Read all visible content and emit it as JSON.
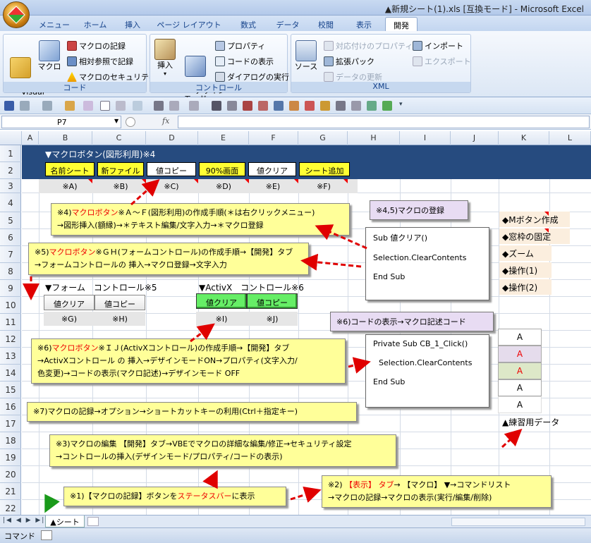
{
  "window": {
    "title": "▲新規シート(1).xls [互換モード] - Microsoft Excel"
  },
  "tabs": [
    {
      "label": "メニュー"
    },
    {
      "label": "ホーム"
    },
    {
      "label": "挿入"
    },
    {
      "label": "ページ レイアウト"
    },
    {
      "label": "数式"
    },
    {
      "label": "データ"
    },
    {
      "label": "校閲"
    },
    {
      "label": "表示"
    },
    {
      "label": "開発"
    }
  ],
  "ribbon": {
    "code": {
      "label": "コード",
      "visual_basic": "Visual\nBasic",
      "macro": "マクロ",
      "record": "マクロの記録",
      "relative": "相対参照で記録",
      "security": "マクロのセキュリティ"
    },
    "controls": {
      "label": "コントロール",
      "insert": "挿入",
      "design": "デザイン\nモード",
      "properties": "プロパティ",
      "view_code": "コードの表示",
      "run_dialog": "ダイアログの実行"
    },
    "xml": {
      "label": "XML",
      "source": "ソース",
      "map_props": "対応付けのプロパティ",
      "expansion": "拡張パック",
      "refresh": "データの更新",
      "import": "インポート",
      "export": "エクスポート"
    }
  },
  "formula_bar": {
    "name_box": "P7",
    "fx": "fx",
    "value": ""
  },
  "columns": [
    "A",
    "B",
    "C",
    "D",
    "E",
    "F",
    "G",
    "H",
    "I",
    "J",
    "K",
    "L"
  ],
  "rows": [
    "1",
    "2",
    "3",
    "4",
    "5",
    "6",
    "7",
    "8",
    "9",
    "10",
    "11",
    "12",
    "13",
    "14",
    "15",
    "16",
    "17",
    "18",
    "19",
    "20",
    "21",
    "22"
  ],
  "sheet": {
    "banner_title": "▼マクロボタン(図形利用)※4",
    "shape_buttons": [
      "名前シート",
      "新ファイル",
      "値コピー",
      "90%画面",
      "値クリア",
      "シート追加"
    ],
    "row3_notes": [
      "※A)",
      "※B)",
      "※C)",
      "※D)",
      "※E)",
      "※F)"
    ],
    "form_title": "▼フォーム　コントロール※5",
    "form_buttons": [
      "値クリア",
      "値コピー"
    ],
    "form_notes": [
      "※G)",
      "※H)"
    ],
    "activex_title": "▼ActivX　コントロール※6",
    "activex_buttons": [
      "値クリア",
      "値コピー"
    ],
    "activex_notes": [
      "※I)",
      "※J)"
    ],
    "callout4_1": "※4)マクロボタン※Ａ～Ｆ(図形利用)の作成手順(＊は右クリックメニュー)",
    "callout4_2": "→図形挿入(額縁)→＊テキスト編集/文字入力→＊マクロ登録",
    "callout5_1": "※5)マクロボタン※ＧＨ(フォームコントロール)の作成手順→【開発】タブ",
    "callout5_2": "→フォームコントロールの 挿入→マクロ登録→文字入力",
    "callout6_1": "※6)マクロボタン※ＩＪ(ActivXコントロール)の作成手順→【開発】タブ",
    "callout6_2": "→ActivXコントロール の 挿入→デザインモードON→プロパティ(文字入力/",
    "callout6_3": "色変更)→コードの表示(マクロ記述)→デザインモード OFF",
    "callout7": "※7)マクロの記録→オプション→ショートカットキーの利用(Ctrl＋指定キー)",
    "callout3_1": "※3)マクロの編集 【開発】タブ→VBEでマクロの詳細な編集/修正→セキュリティ設定",
    "callout3_2": "→コントロールの挿入(デザインモード/プロパティ/コードの表示)",
    "callout1": "※1)【マクロの記録】ボタンをステータスバーに表示",
    "callout2_1": "※2) 【表示】 タブ→ 【マクロ】 ▼→コマンドリスト",
    "callout2_2": "→マクロの記録→マクロの表示(実行/編集/削除)",
    "macro_reg": "※4,5)マクロの登録",
    "code1": [
      "Sub 値クリア()",
      "Selection.ClearContents",
      "End Sub"
    ],
    "code_label": "※6)コードの表示→マクロ記述コード",
    "code2": [
      "Private Sub CB_1_Click()",
      "Selection.ClearContents",
      "End Sub"
    ],
    "right_list": [
      "◆Mボタン作成",
      "◆窓枠の固定",
      "◆ズーム",
      "◆操作(1)",
      "◆操作(2)"
    ],
    "practice_cells": [
      "A",
      "A",
      "A",
      "A",
      "A"
    ],
    "practice_label": "▲練習用データ"
  },
  "sheet_tab": "▲シート",
  "status": {
    "mode": "コマンド"
  },
  "colors": {
    "banner": "#264b7f",
    "callout": "#ffff99",
    "shape_yellow": "#ffff33",
    "activex_green": "#66ee66",
    "arrow": "#e00000"
  }
}
